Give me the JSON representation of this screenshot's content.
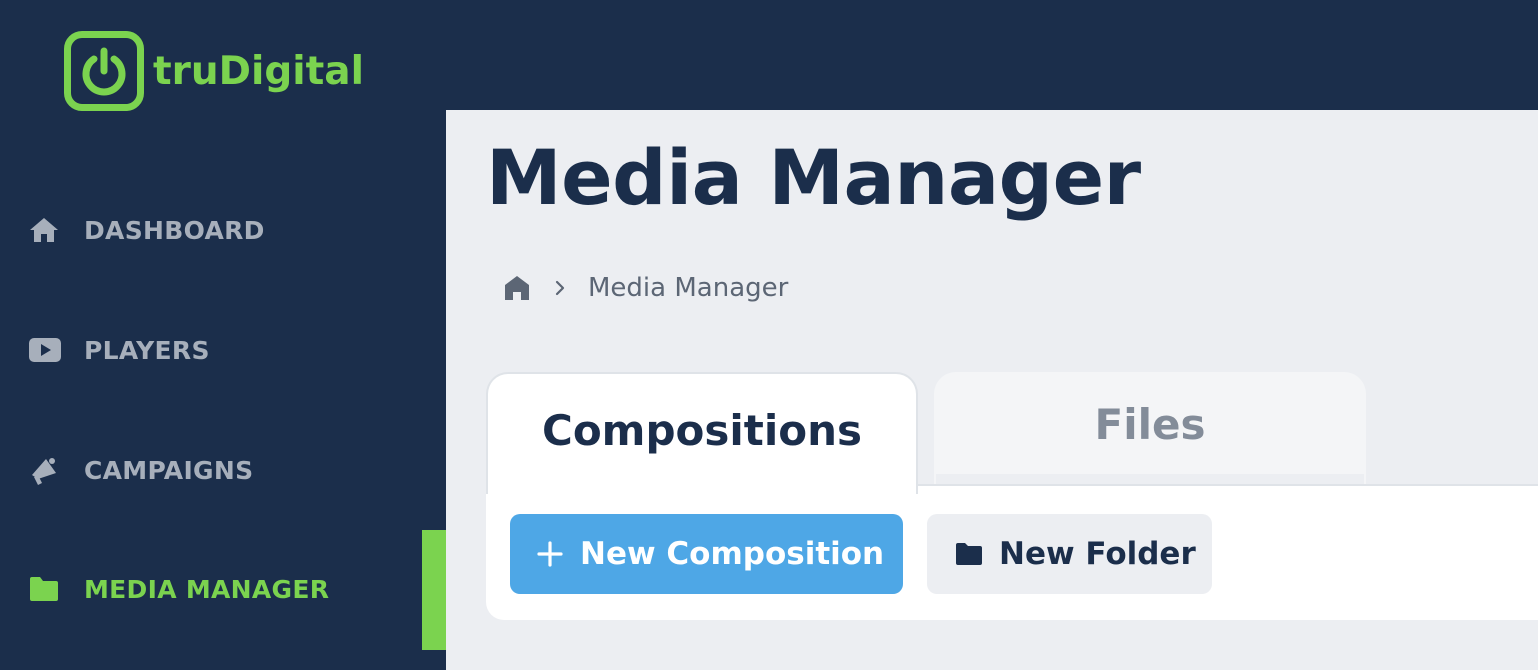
{
  "brand": {
    "name": "truDigital",
    "accent": "#7bd34f",
    "sidebar_bg": "#1b2e4b"
  },
  "sidebar": {
    "items": [
      {
        "label": "DASHBOARD",
        "icon": "home-icon",
        "active": false
      },
      {
        "label": "PLAYERS",
        "icon": "play-icon",
        "active": false
      },
      {
        "label": "CAMPAIGNS",
        "icon": "megaphone-icon",
        "active": false
      },
      {
        "label": "MEDIA MANAGER",
        "icon": "folder-icon",
        "active": true
      }
    ]
  },
  "page": {
    "title": "Media Manager",
    "breadcrumb": {
      "home_icon": "home-icon",
      "current": "Media Manager"
    }
  },
  "tabs": [
    {
      "label": "Compositions",
      "active": true
    },
    {
      "label": "Files",
      "active": false
    }
  ],
  "toolbar": {
    "new_composition_label": "New Composition",
    "new_folder_label": "New Folder",
    "primary_color": "#4ea7e6"
  }
}
